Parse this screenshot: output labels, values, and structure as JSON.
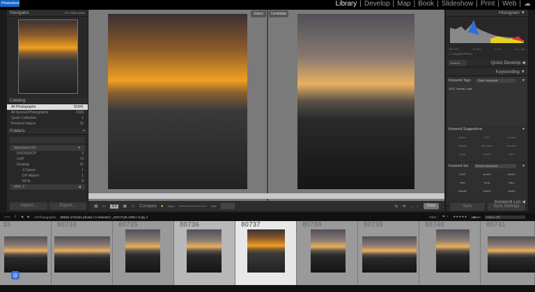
{
  "app": {
    "tag": "Photoshoot",
    "modules": [
      "Library",
      "Develop",
      "Map",
      "Book",
      "Slideshow",
      "Print",
      "Web"
    ],
    "active_module": "Library"
  },
  "navigator": {
    "title": "Navigator",
    "zoom_options": [
      "FIT",
      "100%",
      "200%"
    ]
  },
  "catalog": {
    "title": "Catalog",
    "items": [
      {
        "label": "All Photographs",
        "count": "81941"
      },
      {
        "label": "All Synced Photographs",
        "count": "2326"
      },
      {
        "label": "Quick Collection",
        "count": "1"
      },
      {
        "label": "Previous Import",
        "count": "16"
      }
    ]
  },
  "folders": {
    "title": "Folders",
    "volumes": [
      {
        "label": "Macintosh HD",
        "expanded": true
      },
      {
        "label": "MAC 2",
        "expanded": false
      }
    ],
    "items": [
      {
        "label": "DOCKEDCP",
        "count": "3"
      },
      {
        "label": "CUP",
        "count": "73"
      },
      {
        "label": "Desktop",
        "count": "21"
      },
      {
        "label": "3 Canon",
        "count": "1"
      },
      {
        "label": "DH Waiorn",
        "count": "1"
      },
      {
        "label": "NFTs",
        "count": "8"
      }
    ]
  },
  "left_buttons": {
    "import": "Import...",
    "export": "Export..."
  },
  "compare": {
    "select_label": "Select",
    "candidate_label": "Candidate",
    "toolbar_label": "Compare",
    "zoom_label": "Zoom",
    "zoom_value": "25%",
    "done": "Done"
  },
  "histogram": {
    "title": "Histogram",
    "readouts": [
      "ISO 100",
      "70 mm",
      "f / 16",
      "1/₁₂₅ sec"
    ],
    "original_photo": "Original Photo"
  },
  "right": {
    "saved_preset": "Custom",
    "quick_develop": "Quick Develop",
    "keywording": "Keywording",
    "keyword_tags_label": "Keyword Tags",
    "keyword_tags_mode": "Enter Keywords",
    "keywords": "2022, Hawaii, oahu",
    "suggestions_title": "Keyword Suggestions",
    "suggestions": [
      "skyline",
      "2022",
      "sunset",
      "waikiki",
      "dig island",
      "volcanic",
      "drug",
      "hawaii",
      "oahu"
    ],
    "keyword_set_label": "Keyword Set",
    "keyword_set_value": "Recent Keywords",
    "set_items": [
      "2022",
      "sunset",
      "beach",
      "view",
      "drug",
      "oahu",
      "Hawaii",
      "tourist",
      "ocean"
    ],
    "keyword_list": "Keyword List",
    "sync": "Sync",
    "sync_settings": "Sync Settings"
  },
  "filmstrip": {
    "source": "All Photographs",
    "info": "80849 of 81941 photos / 2 selected / _DSC7125.ARW / Copy 1",
    "filter_label": "Filter :",
    "filter_value": "Filters Off",
    "cells": [
      "33",
      "80734",
      "80735",
      "80736",
      "80737",
      "80738",
      "80739",
      "80740",
      "80741"
    ]
  }
}
